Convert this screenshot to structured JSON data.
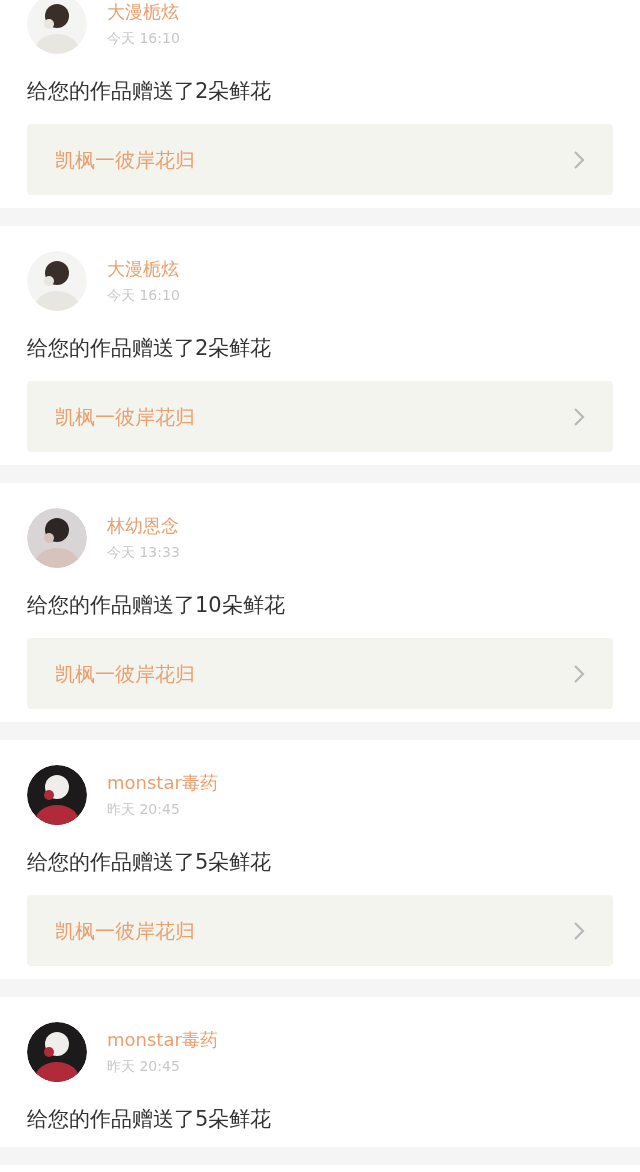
{
  "notifications": [
    {
      "user": "大漫栀炫",
      "time": "今天 16:10",
      "message": "给您的作品赠送了2朵鲜花",
      "work": "凯枫一彼岸花归"
    },
    {
      "user": "大漫栀炫",
      "time": "今天 16:10",
      "message": "给您的作品赠送了2朵鲜花",
      "work": "凯枫一彼岸花归"
    },
    {
      "user": "林幼恩念",
      "time": "今天 13:33",
      "message": "给您的作品赠送了10朵鲜花",
      "work": "凯枫一彼岸花归"
    },
    {
      "user": "monstar毒药",
      "time": "昨天 20:45",
      "message": "给您的作品赠送了5朵鲜花",
      "work": "凯枫一彼岸花归"
    },
    {
      "user": "monstar毒药",
      "time": "昨天 20:45",
      "message": "给您的作品赠送了5朵鲜花"
    }
  ]
}
